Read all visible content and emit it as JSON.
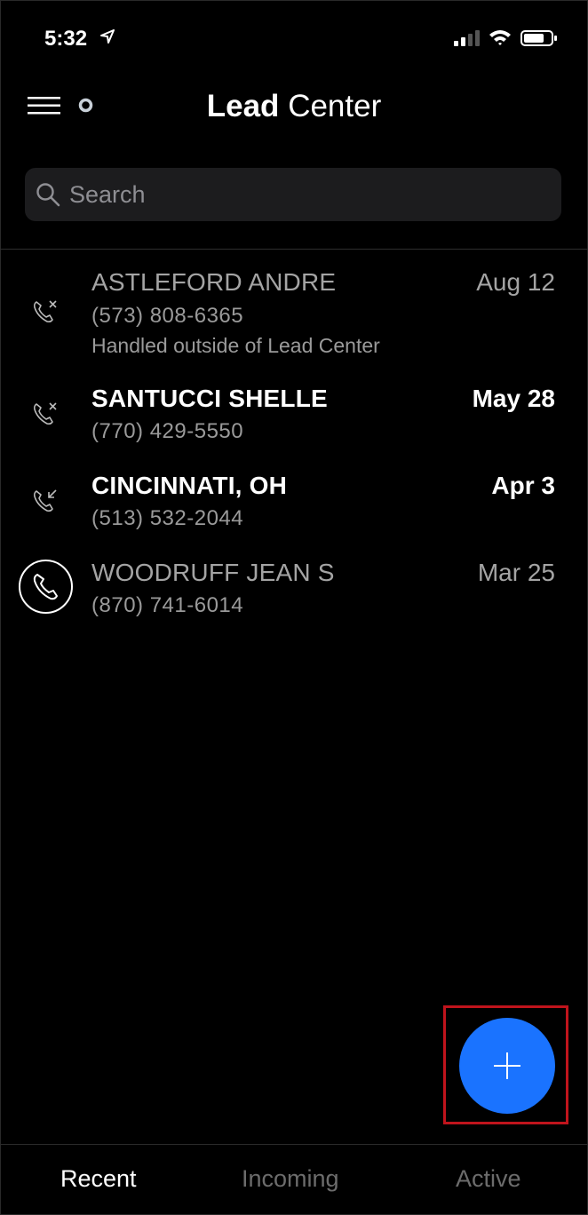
{
  "status_bar": {
    "time": "5:32"
  },
  "header": {
    "title_bold": "Lead",
    "title_light": "Center"
  },
  "search": {
    "placeholder": "Search",
    "value": ""
  },
  "calls": [
    {
      "name": "ASTLEFORD ANDRE",
      "phone": "(573) 808-6365",
      "note": "Handled outside of Lead Center",
      "date": "Aug 12",
      "icon": "missed-call-icon"
    },
    {
      "name": "SANTUCCI SHELLE",
      "phone": "(770) 429-5550",
      "date": "May 28",
      "icon": "missed-call-icon"
    },
    {
      "name": "CINCINNATI, OH",
      "phone": "(513) 532-2044",
      "date": "Apr 3",
      "icon": "incoming-call-icon"
    },
    {
      "name": "WOODRUFF JEAN S",
      "phone": "(870) 741-6014",
      "date": "Mar 25",
      "icon": "phone-circle-icon"
    }
  ],
  "fab": {
    "icon": "plus-icon",
    "accent": "#1a73ff"
  },
  "tabs": [
    {
      "label": "Recent",
      "active": true
    },
    {
      "label": "Incoming",
      "active": false
    },
    {
      "label": "Active",
      "active": false
    }
  ]
}
